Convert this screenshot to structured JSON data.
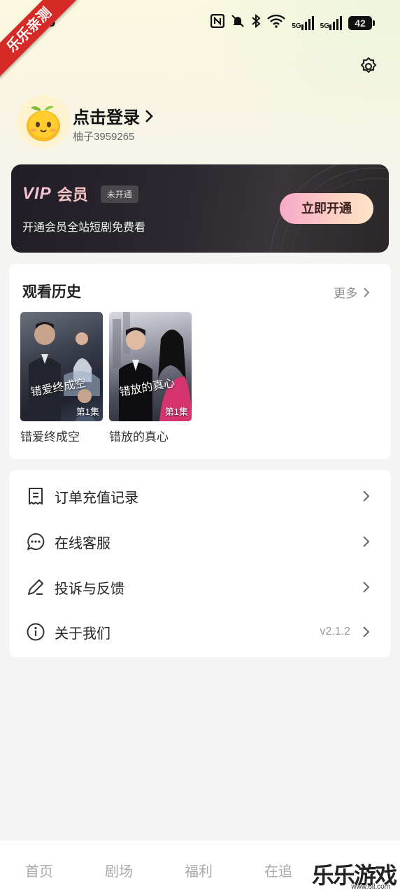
{
  "ribbon": "乐乐亲测",
  "status_bar": {
    "time": "26",
    "network": "5G",
    "battery": "42"
  },
  "profile": {
    "login": "点击登录",
    "user_id": "柚子3959265"
  },
  "vip": {
    "logo": "VIP",
    "title": "会员",
    "badge": "未开通",
    "description": "开通会员全站短剧免费看",
    "button": "立即开通"
  },
  "history": {
    "title": "观看历史",
    "more": "更多",
    "items": [
      {
        "name": "错爱终成空",
        "poster_title": "错爱终成空",
        "episode": "第1集"
      },
      {
        "name": "错放的真心",
        "poster_title": "错放的真心",
        "episode": "第1集"
      }
    ]
  },
  "menu": {
    "items": [
      {
        "label": "订单充值记录",
        "value": ""
      },
      {
        "label": "在线客服",
        "value": ""
      },
      {
        "label": "投诉与反馈",
        "value": ""
      },
      {
        "label": "关于我们",
        "value": "v2.1.2"
      }
    ]
  },
  "bottom_nav": {
    "items": [
      "首页",
      "剧场",
      "福利",
      "在追"
    ]
  },
  "watermark": {
    "text": "乐乐游戏",
    "url": "www.6ll.com"
  }
}
